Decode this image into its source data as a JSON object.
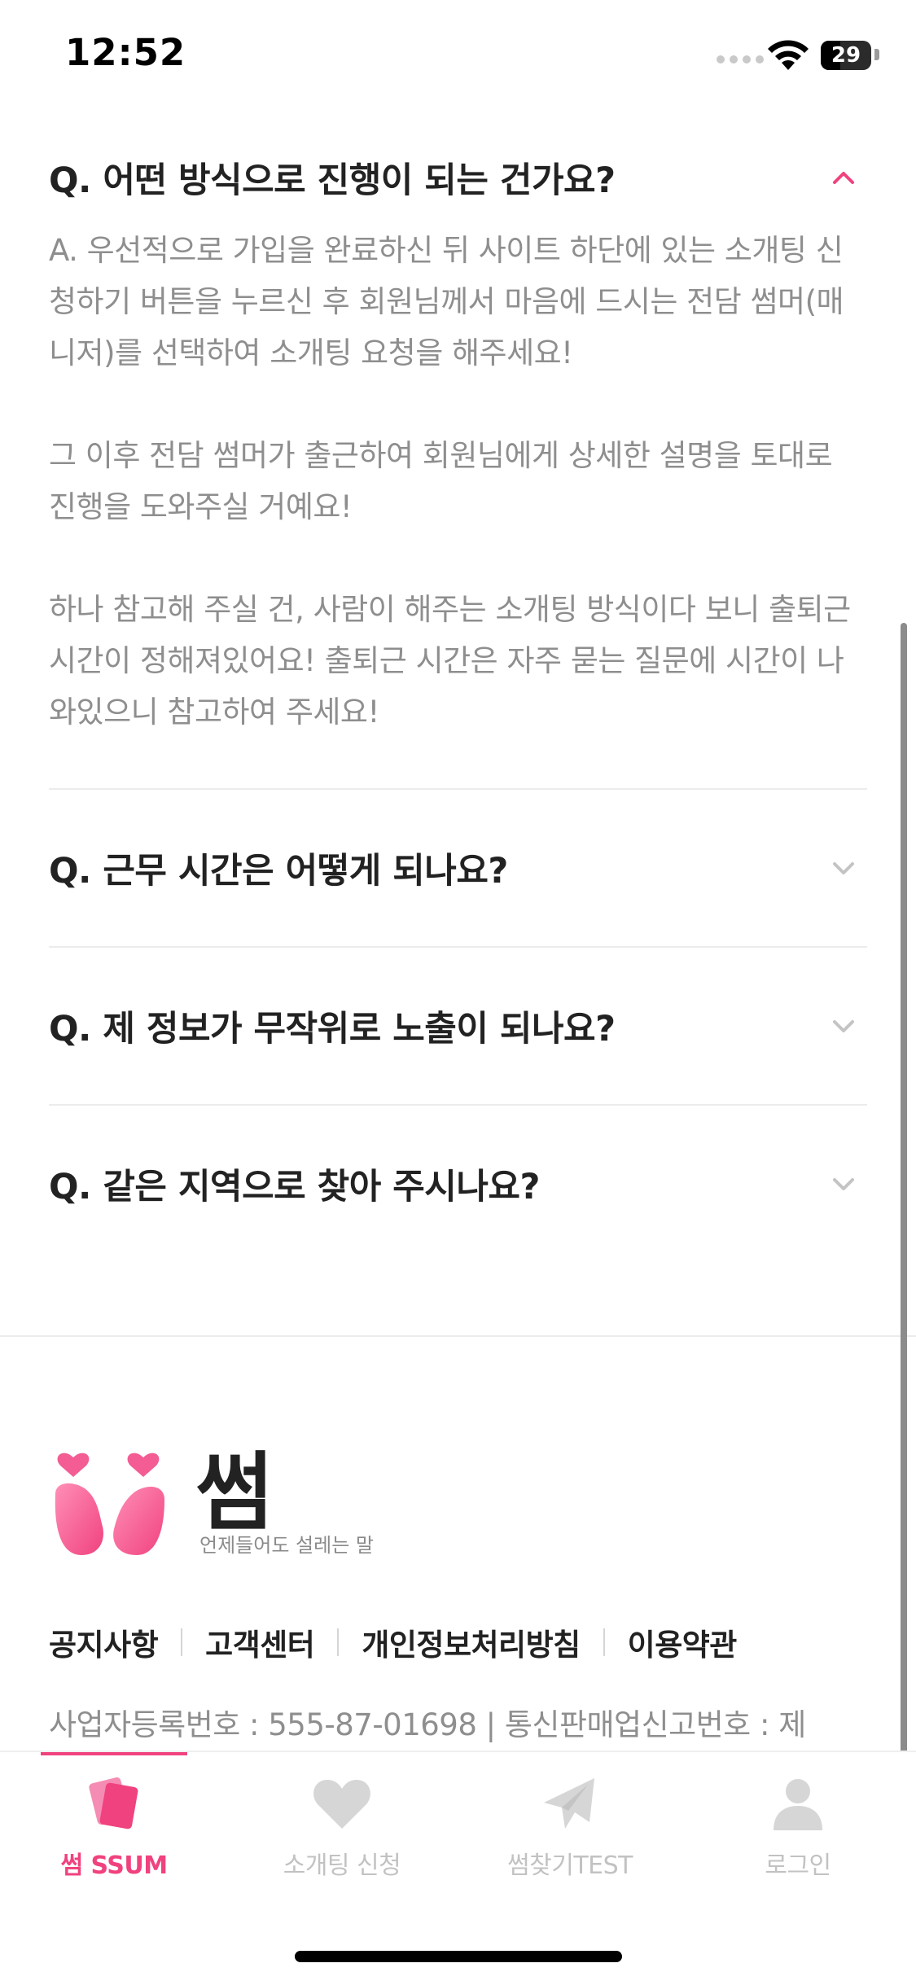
{
  "status_bar": {
    "time": "12:52",
    "battery": "29"
  },
  "faq": [
    {
      "question": "Q. 어떤 방식으로 진행이 되는 건가요?",
      "expanded": true,
      "answer": [
        "A. 우선적으로 가입을 완료하신 뒤 사이트 하단에 있는 소개팅 신청하기 버튼을 누르신 후 회원님께서 마음에 드시는 전담 썸머(매니저)를 선택하여 소개팅 요청을 해주세요!",
        "그 이후 전담 썸머가 출근하여 회원님에게 상세한 설명을 토대로 진행을 도와주실 거예요!",
        "하나 참고해 주실 건, 사람이 해주는 소개팅 방식이다 보니 출퇴근 시간이 정해져있어요! 출퇴근 시간은 자주 묻는 질문에 시간이 나와있으니 참고하여 주세요!"
      ]
    },
    {
      "question": "Q. 근무 시간은 어떻게 되나요?",
      "expanded": false
    },
    {
      "question": "Q. 제 정보가 무작위로 노출이 되나요?",
      "expanded": false
    },
    {
      "question": "Q. 같은 지역으로 찾아 주시나요?",
      "expanded": false
    }
  ],
  "footer": {
    "brand_name": "썸",
    "slogan": "언제들어도 설레는 말",
    "links": [
      "공지사항",
      "고객센터",
      "개인정보처리방침",
      "이용약관"
    ],
    "biz_info": "사업자등록번호 : 555-87-01698 | 통신판매업신고번호 : 제"
  },
  "tabs": [
    {
      "label": "썸 SSUM",
      "icon": "cards-icon",
      "active": true
    },
    {
      "label": "소개팅 신청",
      "icon": "heart-icon",
      "active": false
    },
    {
      "label": "썸찾기TEST",
      "icon": "paper-plane-icon",
      "active": false
    },
    {
      "label": "로그인",
      "icon": "person-icon",
      "active": false
    }
  ],
  "colors": {
    "accent": "#f0427f",
    "inactive": "#c2c2c2",
    "answer_text": "#8e8e8e"
  }
}
